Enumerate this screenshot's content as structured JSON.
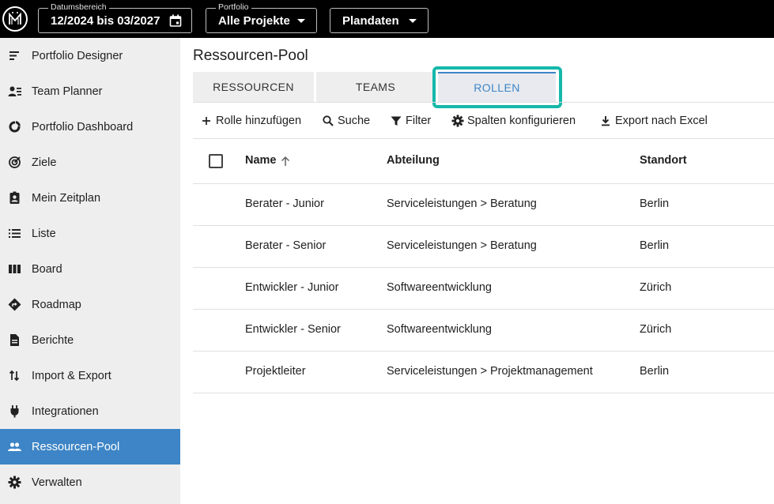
{
  "topbar": {
    "date_range": {
      "legend": "Datumsbereich",
      "value": "12/2024 bis 03/2027"
    },
    "portfolio": {
      "legend": "Portfolio",
      "value": "Alle Projekte"
    },
    "plandaten": {
      "value": "Plandaten"
    }
  },
  "sidebar": {
    "items": [
      {
        "label": "Portfolio Designer",
        "icon": "sort-list-icon"
      },
      {
        "label": "Team Planner",
        "icon": "person-list-icon"
      },
      {
        "label": "Portfolio Dashboard",
        "icon": "donut-chart-icon"
      },
      {
        "label": "Ziele",
        "icon": "target-icon"
      },
      {
        "label": "Mein Zeitplan",
        "icon": "badge-person-icon"
      },
      {
        "label": "Liste",
        "icon": "list-icon"
      },
      {
        "label": "Board",
        "icon": "board-columns-icon"
      },
      {
        "label": "Roadmap",
        "icon": "directions-icon"
      },
      {
        "label": "Berichte",
        "icon": "document-icon"
      },
      {
        "label": "Import & Export",
        "icon": "import-export-icon"
      },
      {
        "label": "Integrationen",
        "icon": "plug-icon"
      },
      {
        "label": "Ressourcen-Pool",
        "icon": "people-icon",
        "active": true
      },
      {
        "label": "Verwalten",
        "icon": "gear-icon"
      }
    ]
  },
  "main": {
    "title": "Ressourcen-Pool",
    "tabs": [
      {
        "label": "RESSOURCEN"
      },
      {
        "label": "TEAMS"
      },
      {
        "label": "ROLLEN",
        "active": true
      }
    ],
    "toolbar": {
      "add_role": "Rolle hinzufügen",
      "search": "Suche",
      "filter": "Filter",
      "configure_columns": "Spalten konfigurieren",
      "export_excel": "Export nach Excel"
    },
    "table": {
      "columns": {
        "name": "Name",
        "department": "Abteilung",
        "location": "Standort"
      },
      "rows": [
        {
          "name": "Berater - Junior",
          "department": "Serviceleistungen > Beratung",
          "location": "Berlin"
        },
        {
          "name": "Berater - Senior",
          "department": "Serviceleistungen > Beratung",
          "location": "Berlin"
        },
        {
          "name": "Entwickler - Junior",
          "department": "Softwareentwicklung",
          "location": "Zürich"
        },
        {
          "name": "Entwickler - Senior",
          "department": "Softwareentwicklung",
          "location": "Zürich"
        },
        {
          "name": "Projektleiter",
          "department": "Serviceleistungen > Projektmanagement",
          "location": "Berlin"
        }
      ]
    }
  },
  "colors": {
    "accent": "#3d85c6",
    "highlight": "#14b8aa",
    "topbar": "#000000",
    "sidebar": "#eeeeee"
  }
}
